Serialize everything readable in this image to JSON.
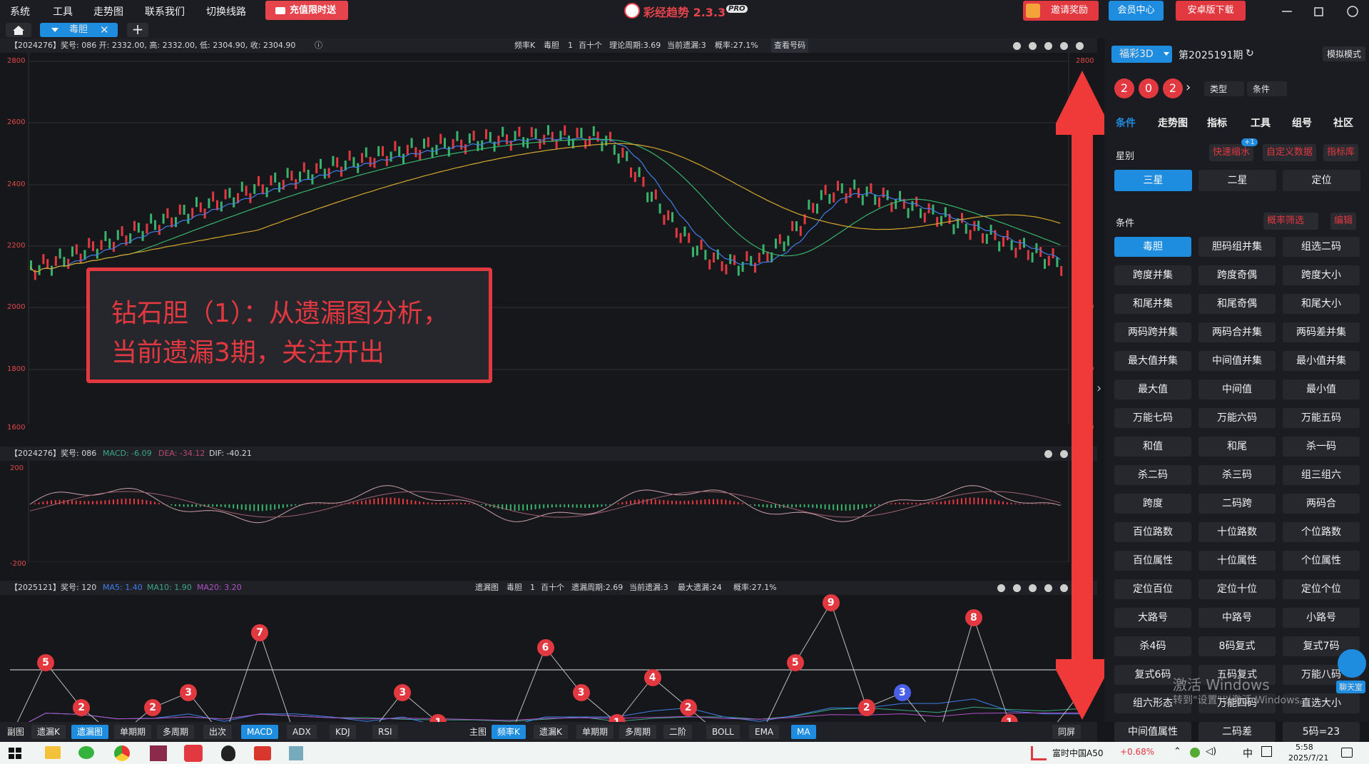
{
  "menu": [
    "系统",
    "工具",
    "走势图",
    "联系我们",
    "切换线路"
  ],
  "promo_label": "充值限时送",
  "app_title": "彩经趋势 2.3.3",
  "app_badge": "PRO",
  "top_buttons": {
    "invite": "邀请奖励",
    "vip": "会员中心",
    "android": "安卓版下载"
  },
  "tab": {
    "label": "毒胆"
  },
  "kline_info": {
    "left": "【2024276】奖号: 086  开: 2332.00, 高: 2332.00, 低: 2304.90, 收: 2304.90",
    "center_items": [
      "频率K",
      "毒胆",
      "1",
      "百十个",
      "理论周期:3.69",
      "当前遗漏:3",
      "概率:27.1%",
      "查看号码"
    ]
  },
  "kline_axis": [
    "2800",
    "2600",
    "2400",
    "2200",
    "2000",
    "1800",
    "1600"
  ],
  "macd_info": {
    "left": "【2024276】奖号: 086",
    "macd": "MACD: -6.09",
    "dea": "DEA: -34.12",
    "dif": "DIF: -40.21"
  },
  "macd_axis": [
    "200",
    "-200"
  ],
  "miss_info": {
    "left": "【2025121】奖号: 120",
    "ma5": "MA5: 1.40",
    "ma10": "MA10: 1.90",
    "ma20": "MA20: 3.20",
    "center_items": [
      "遗漏图",
      "毒胆",
      "1",
      "百十个",
      "遗漏周期:2.69",
      "当前遗漏:3",
      "最大遗漏:24",
      "概率:27.1%"
    ]
  },
  "miss_values": [
    0,
    5,
    2,
    0,
    2,
    3,
    0,
    7,
    0,
    0,
    0,
    3,
    1,
    0,
    0,
    6,
    3,
    1,
    4,
    2,
    0,
    0,
    5,
    9,
    2,
    3,
    0,
    8,
    1,
    0,
    3
  ],
  "annotation": {
    "line1": "钻石胆（1）：从遗漏图分析，",
    "line2": "当前遗漏3期，关注开出"
  },
  "bottom_left": {
    "label": "副图",
    "buttons": [
      "遗漏K",
      "遗漏图",
      "单期期",
      "多周期",
      "出次",
      "MACD",
      "ADX",
      "KDJ",
      "RSI"
    ]
  },
  "bottom_main": {
    "label": "主图",
    "buttons": [
      "频率K",
      "遗漏K",
      "单期期",
      "多周期",
      "二阶",
      "BOLL",
      "EMA",
      "MA"
    ]
  },
  "bottom_right": "同屏",
  "right": {
    "lottery": "福彩3D",
    "issue": "第2025191期",
    "mode": "模拟模式",
    "balls": [
      "2",
      "0",
      "2"
    ],
    "type_label": "类型",
    "cond_label": "条件",
    "tabs": [
      "条件",
      "走势图",
      "指标",
      "工具",
      "组号",
      "社区"
    ],
    "star_label": "星别",
    "quick": "快速缩水",
    "badge": "+1",
    "custom": "自定义数据",
    "lib": "指标库",
    "stars": [
      "三星",
      "二星",
      "定位"
    ],
    "cond_title": "条件",
    "filter": "概率筛选",
    "edit": "编辑",
    "conditions": [
      "毒胆",
      "胆码组并集",
      "组选二码",
      "跨度并集",
      "跨度奇偶",
      "跨度大小",
      "和尾并集",
      "和尾奇偶",
      "和尾大小",
      "两码跨并集",
      "两码合并集",
      "两码差并集",
      "最大值并集",
      "中间值并集",
      "最小值并集",
      "最大值",
      "中间值",
      "最小值",
      "万能七码",
      "万能六码",
      "万能五码",
      "和值",
      "和尾",
      "杀一码",
      "杀二码",
      "杀三码",
      "组三组六",
      "跨度",
      "二码跨",
      "两码合",
      "百位路数",
      "十位路数",
      "个位路数",
      "百位属性",
      "十位属性",
      "个位属性",
      "定位百位",
      "定位十位",
      "定位个位",
      "大路号",
      "中路号",
      "小路号",
      "杀4码",
      "8码复式",
      "复式7码",
      "复式6码",
      "五码复式",
      "万能八码",
      "组六形态",
      "万能四码",
      "直选大小",
      "中间值属性",
      "二码差",
      "5码=23"
    ],
    "chat": "聊天室",
    "watermark1": "激活 Windows",
    "watermark2": "转到\"设置\"以激活 Windows。"
  },
  "taskbar": {
    "stock": "富时中国A50",
    "change": "+0.68%",
    "ime": "中",
    "time": "5:58",
    "date": "2025/7/21"
  }
}
